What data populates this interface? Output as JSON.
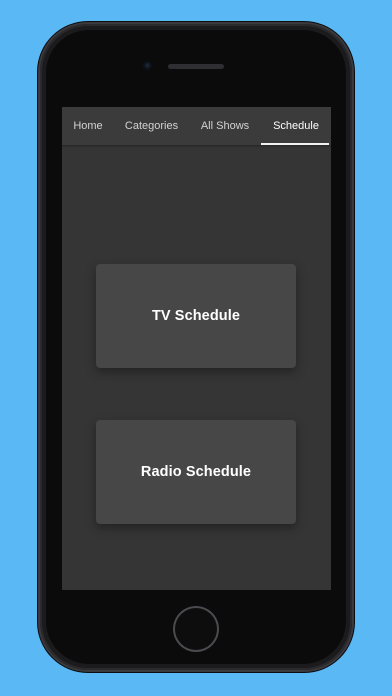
{
  "tabs": [
    {
      "label": "Home",
      "selected": false
    },
    {
      "label": "Categories",
      "selected": false
    },
    {
      "label": "All Shows",
      "selected": false
    },
    {
      "label": "Schedule",
      "selected": true
    }
  ],
  "cards": {
    "tv": {
      "label": "TV Schedule"
    },
    "radio": {
      "label": "Radio Schedule"
    }
  },
  "colors": {
    "background": "#5ab8f5",
    "screen": "#353535",
    "tabbar": "#3b3b3b",
    "card": "#474747",
    "text": "#ffffff"
  }
}
